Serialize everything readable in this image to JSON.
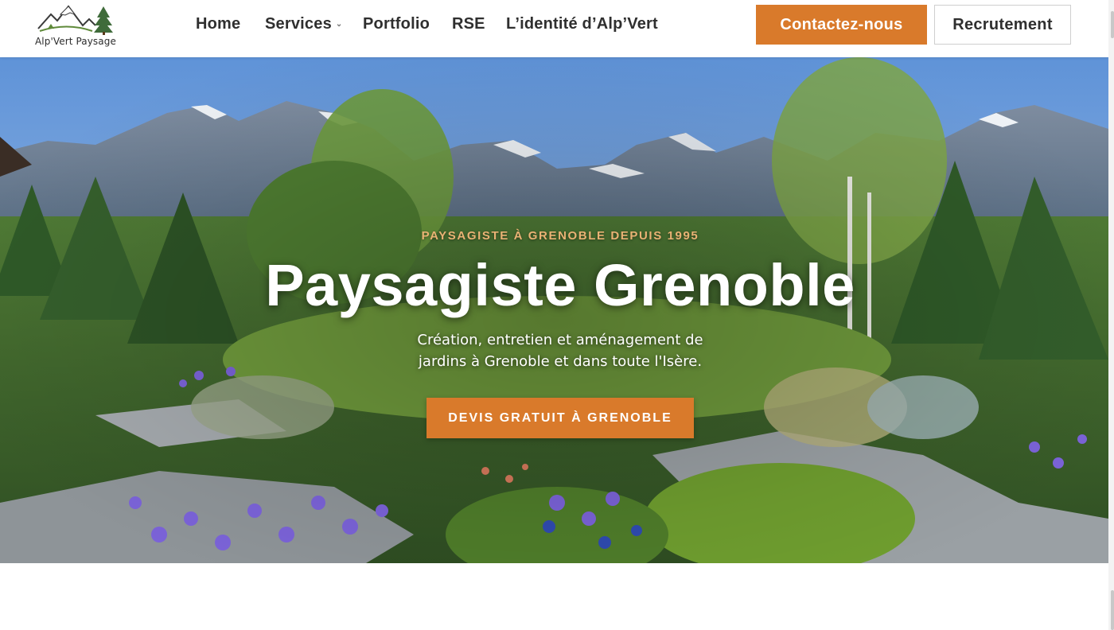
{
  "brand": {
    "logo_text": "Alp'Vert Paysage",
    "logo_icon": "mountain-fir-logo",
    "accent_color": "#d97a2b"
  },
  "nav": {
    "items": [
      {
        "label": "Home"
      },
      {
        "label": "Services",
        "has_dropdown": true,
        "dropdown_icon": "chevron-down-icon"
      },
      {
        "label": "Portfolio"
      },
      {
        "label": "RSE"
      },
      {
        "label": "L’identité d’Alp’Vert"
      }
    ]
  },
  "header_buttons": {
    "contact_label": "Contactez-nous",
    "recruit_label": "Recrutement"
  },
  "hero": {
    "eyebrow": "PAYSAGISTE À GRENOBLE DEPUIS 1995",
    "title": "Paysagiste Grenoble",
    "subtitle": "Création, entretien et aménagement de jardins à Grenoble et dans toute l'Isère.",
    "cta_label": "DEVIS GRATUIT À GRENOBLE",
    "background": "alpine-garden-photo"
  }
}
